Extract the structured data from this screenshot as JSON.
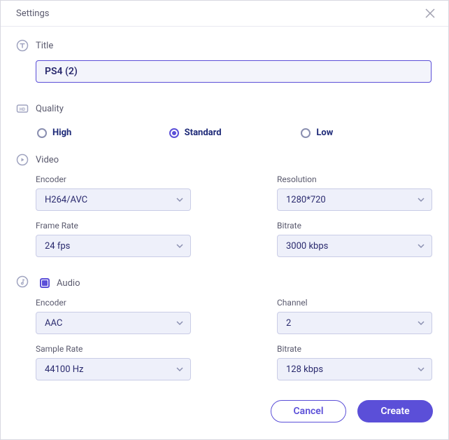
{
  "header": {
    "title": "Settings"
  },
  "title": {
    "label": "Title",
    "value": "PS4 (2)"
  },
  "quality": {
    "label": "Quality",
    "options": [
      {
        "label": "High",
        "selected": false
      },
      {
        "label": "Standard",
        "selected": true
      },
      {
        "label": "Low",
        "selected": false
      }
    ]
  },
  "video": {
    "label": "Video",
    "encoder": {
      "label": "Encoder",
      "value": "H264/AVC"
    },
    "resolution": {
      "label": "Resolution",
      "value": "1280*720"
    },
    "framerate": {
      "label": "Frame Rate",
      "value": "24 fps"
    },
    "bitrate": {
      "label": "Bitrate",
      "value": "3000 kbps"
    }
  },
  "audio": {
    "label": "Audio",
    "enabled": true,
    "encoder": {
      "label": "Encoder",
      "value": "AAC"
    },
    "channel": {
      "label": "Channel",
      "value": "2"
    },
    "samplerate": {
      "label": "Sample Rate",
      "value": "44100 Hz"
    },
    "bitrate": {
      "label": "Bitrate",
      "value": "128 kbps"
    }
  },
  "footer": {
    "cancel": "Cancel",
    "create": "Create"
  }
}
